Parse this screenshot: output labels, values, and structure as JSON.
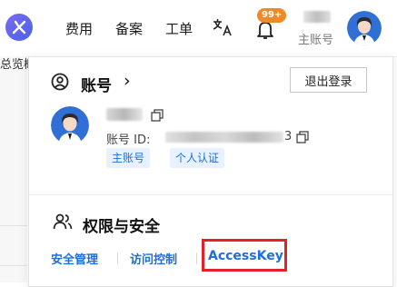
{
  "topbar": {
    "nav": [
      "费用",
      "备案",
      "工单"
    ],
    "badge": "99+",
    "user_role": "主账号",
    "icons": [
      "logo-icon",
      "translate-icon",
      "notification-bell-icon",
      "avatar"
    ]
  },
  "background": {
    "partial_text": "总览概览"
  },
  "account": {
    "title": "账号",
    "title_arrow": "›",
    "logout_label": "退出登录",
    "account_id_label": "账号 ID:",
    "account_id_visible_suffix": "3",
    "tags": [
      "主账号",
      "个人认证"
    ]
  },
  "security": {
    "title": "权限与安全",
    "links": [
      "安全管理",
      "访问控制",
      "AccessKey"
    ]
  },
  "colors": {
    "link": "#1e6fd9",
    "highlight": "#e5202a",
    "badge": "#f08a24",
    "tag_bg": "#e8f1ff"
  }
}
